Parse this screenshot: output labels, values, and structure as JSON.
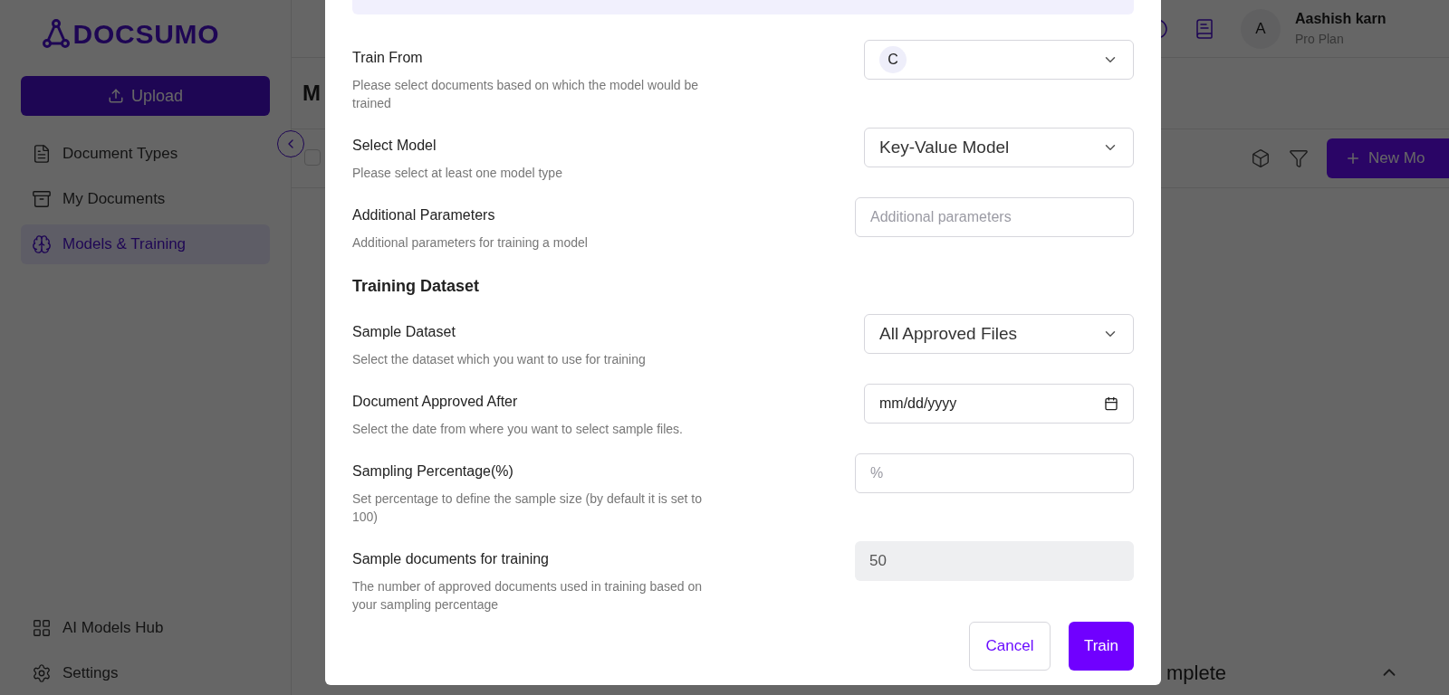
{
  "sidebar": {
    "logo": "DOCSUMO",
    "upload_button": "Upload",
    "nav_items": [
      {
        "label": "Document Types",
        "selected": false
      },
      {
        "label": "My Documents",
        "selected": false
      },
      {
        "label": "Models & Training",
        "selected": true
      }
    ],
    "bottom_items": [
      {
        "label": "AI Models Hub",
        "selected": false
      },
      {
        "label": "Settings",
        "selected": false
      }
    ]
  },
  "header": {
    "avatar": "A",
    "user_name": "Aashish karn",
    "plan": "Pro Plan"
  },
  "page": {
    "title": "M",
    "checkbox": {
      "checked": false
    },
    "new_button": "New Mo",
    "footer_text": "mplete"
  },
  "dialog": {
    "fields": [
      {
        "kind": "chip-select",
        "label": "Train From",
        "description": "Please select documents based on which the model would be trained",
        "value": "C"
      },
      {
        "kind": "select",
        "label": "Select Model",
        "description": "Please select at least one model type",
        "value": "Key-Value Model"
      },
      {
        "kind": "input",
        "label": "Additional Parameters",
        "description": "Additional parameters for training a model",
        "placeholder": "Additional parameters"
      },
      {
        "kind": "heading",
        "label": "Training Dataset"
      },
      {
        "kind": "select",
        "label": "Sample Dataset",
        "description": "Select the dataset which you want to use for training",
        "value": "All Approved Files"
      },
      {
        "kind": "date",
        "label": "Document Approved After",
        "description": "Select the date from where you want to select sample files.",
        "value": "mm/dd/yyyy"
      },
      {
        "kind": "input",
        "label": "Sampling Percentage(%)",
        "description": "Set percentage to define the sample size (by default it is set to 100)",
        "placeholder": "%"
      },
      {
        "kind": "readonly",
        "label": "Sample documents for training",
        "description": "The number of approved documents used in training based on your sampling percentage",
        "value": "50"
      }
    ],
    "cancel_button": "Cancel",
    "train_button": "Train"
  }
}
